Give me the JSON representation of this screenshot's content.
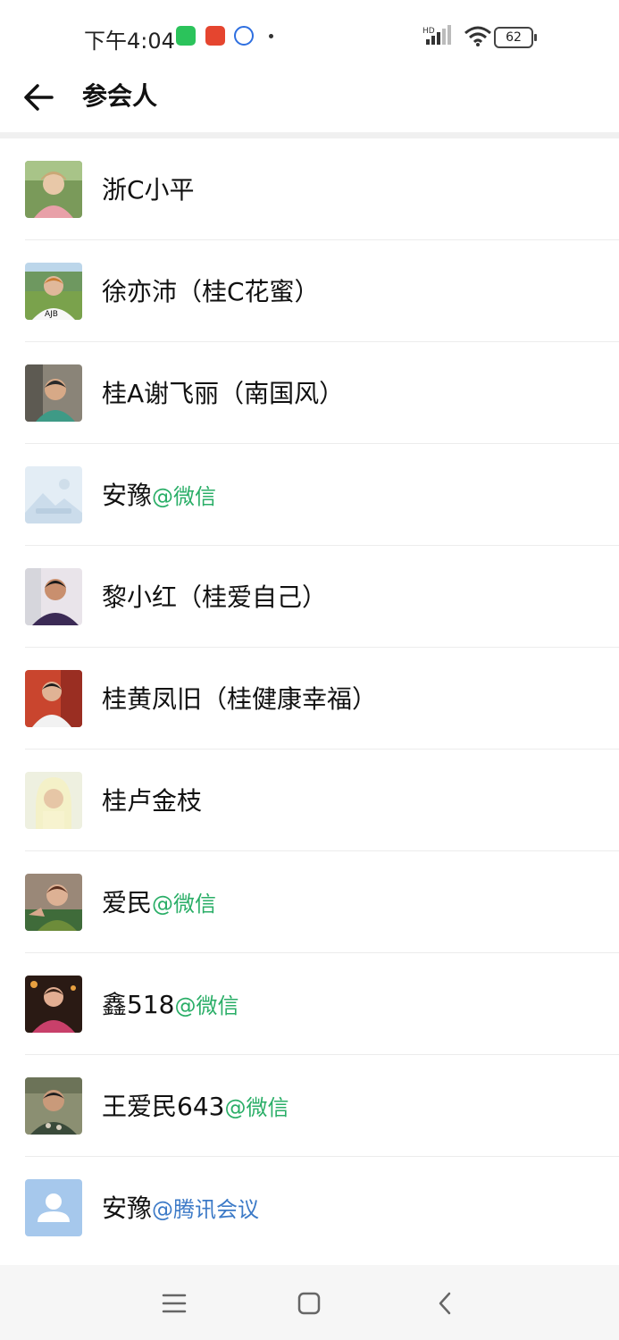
{
  "status_bar": {
    "time": "下午4:04",
    "network": "HD",
    "battery": "62",
    "icons": [
      "wechat-icon",
      "pinduoduo-icon",
      "baidu-icon",
      "signal-icon",
      "wifi-icon",
      "battery-icon"
    ]
  },
  "header": {
    "title": "参会人"
  },
  "participants": [
    {
      "name": "浙C小平",
      "suffix": ""
    },
    {
      "name": "徐亦沛（桂C花蜜）",
      "suffix": ""
    },
    {
      "name": "桂A谢飞丽（南国风）",
      "suffix": ""
    },
    {
      "name": "安豫",
      "suffix": "@微信"
    },
    {
      "name": "黎小红（桂爱自己）",
      "suffix": ""
    },
    {
      "name": "桂黄凤旧（桂健康幸福）",
      "suffix": ""
    },
    {
      "name": "桂卢金枝",
      "suffix": ""
    },
    {
      "name": "爱民",
      "suffix": "@微信"
    },
    {
      "name": "鑫518",
      "suffix": "@微信"
    },
    {
      "name": "王爱民643",
      "suffix": "@微信"
    },
    {
      "name": "安豫",
      "suffix": "@腾讯会议"
    }
  ],
  "colors": {
    "wechat_suffix": "#2aae67",
    "tencent_suffix": "#3c7ac7"
  }
}
